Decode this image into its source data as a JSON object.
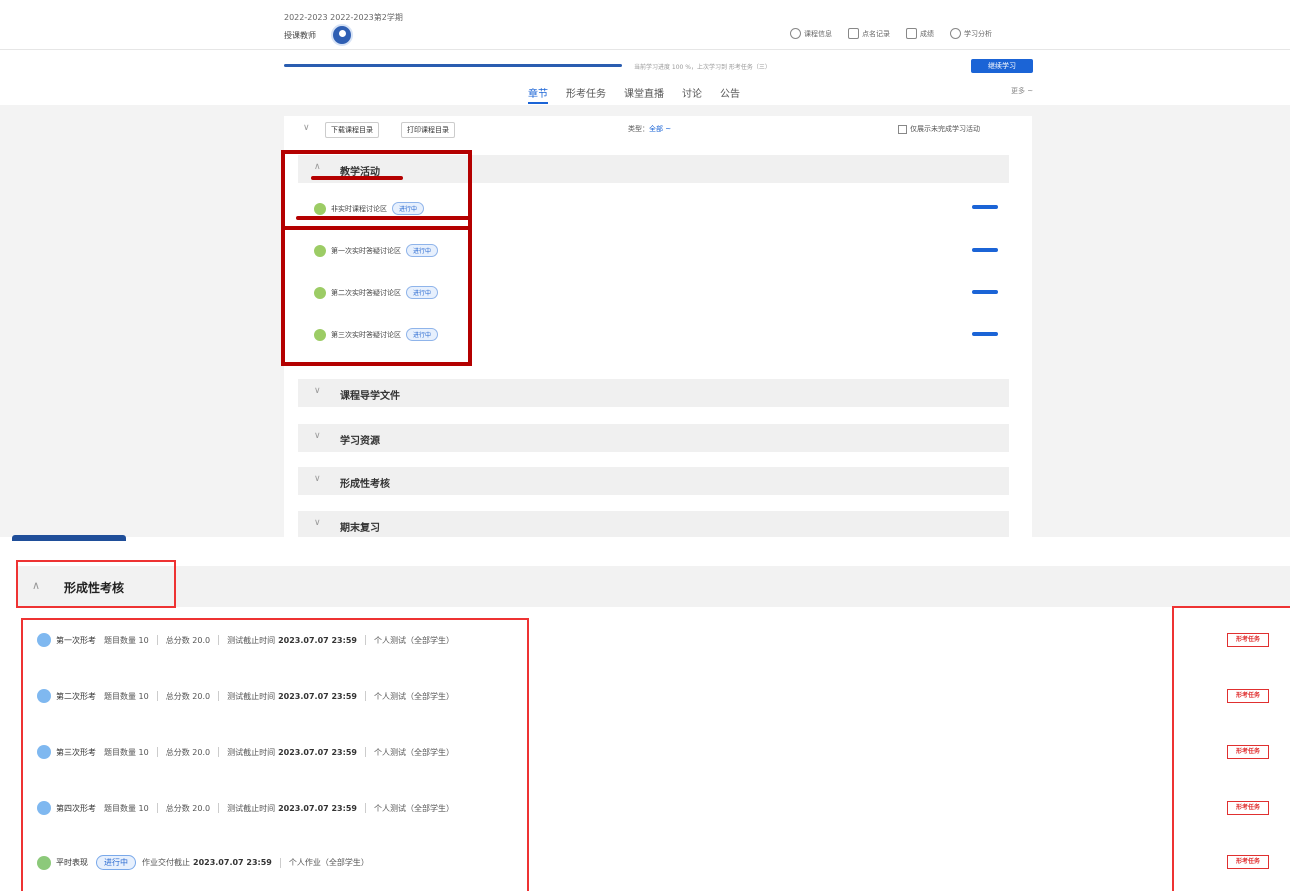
{
  "header": {
    "term": "2022-2023 2022-2023第2学期",
    "teacher_label": "授课教师",
    "links": [
      {
        "icon": "course-info-icon",
        "label": "课程信息"
      },
      {
        "icon": "notes-icon",
        "label": "点名记录"
      },
      {
        "icon": "trophy-icon",
        "label": "成绩"
      },
      {
        "icon": "analysis-icon",
        "label": "学习分析"
      }
    ],
    "progress_text": "当前学习进度 100 %，上次学习到 形考任务（三）",
    "progress_fraction": 1.0,
    "continue_button": "继续学习",
    "tabs": [
      "章节",
      "形考任务",
      "课堂直播",
      "讨论",
      "公告"
    ],
    "active_tab": "章节",
    "more": "更多 ~"
  },
  "toolbar": {
    "download_catalog": "下载课程目录",
    "print_catalog": "打印课程目录",
    "type_label": "类型：",
    "type_value": "全部 ~",
    "only_incomplete": "仅展示未完成学习活动"
  },
  "sections": [
    {
      "title": "教学活动",
      "expanded": true
    },
    {
      "title": "课程导学文件",
      "expanded": false
    },
    {
      "title": "学习资源",
      "expanded": false
    },
    {
      "title": "形成性考核",
      "expanded": false
    },
    {
      "title": "期末复习",
      "expanded": false
    }
  ],
  "activities": [
    {
      "name": "非实时课程讨论区",
      "status": "进行中"
    },
    {
      "name": "第一次实时答疑讨论区",
      "status": "进行中"
    },
    {
      "name": "第二次实时答疑讨论区",
      "status": "进行中"
    },
    {
      "name": "第三次实时答疑讨论区",
      "status": "进行中"
    }
  ],
  "assessment": {
    "title": "形成性考核",
    "items": [
      {
        "name": "第一次形考",
        "q_label": "题目数量",
        "q": "10",
        "score_label": "总分数",
        "score": "20.0",
        "deadline_label": "测试截止时间",
        "deadline": "2023.07.07 23:59",
        "scope": "个人测试（全部学生）",
        "tag": "形考任务"
      },
      {
        "name": "第二次形考",
        "q_label": "题目数量",
        "q": "10",
        "score_label": "总分数",
        "score": "20.0",
        "deadline_label": "测试截止时间",
        "deadline": "2023.07.07 23:59",
        "scope": "个人测试（全部学生）",
        "tag": "形考任务"
      },
      {
        "name": "第三次形考",
        "q_label": "题目数量",
        "q": "10",
        "score_label": "总分数",
        "score": "20.0",
        "deadline_label": "测试截止时间",
        "deadline": "2023.07.07 23:59",
        "scope": "个人测试（全部学生）",
        "tag": "形考任务"
      },
      {
        "name": "第四次形考",
        "q_label": "题目数量",
        "q": "10",
        "score_label": "总分数",
        "score": "20.0",
        "deadline_label": "测试截止时间",
        "deadline": "2023.07.07 23:59",
        "scope": "个人测试（全部学生）",
        "tag": "形考任务"
      }
    ],
    "daily": {
      "name": "平时表现",
      "status": "进行中",
      "deadline_label": "作业交付截止",
      "deadline": "2023.07.07 23:59",
      "scope": "个人作业（全部学生）",
      "tag": "形考任务"
    }
  },
  "colors": {
    "accent": "#1b64d6",
    "annotation_red": "#b40000",
    "stamp_red": "#e03030"
  }
}
